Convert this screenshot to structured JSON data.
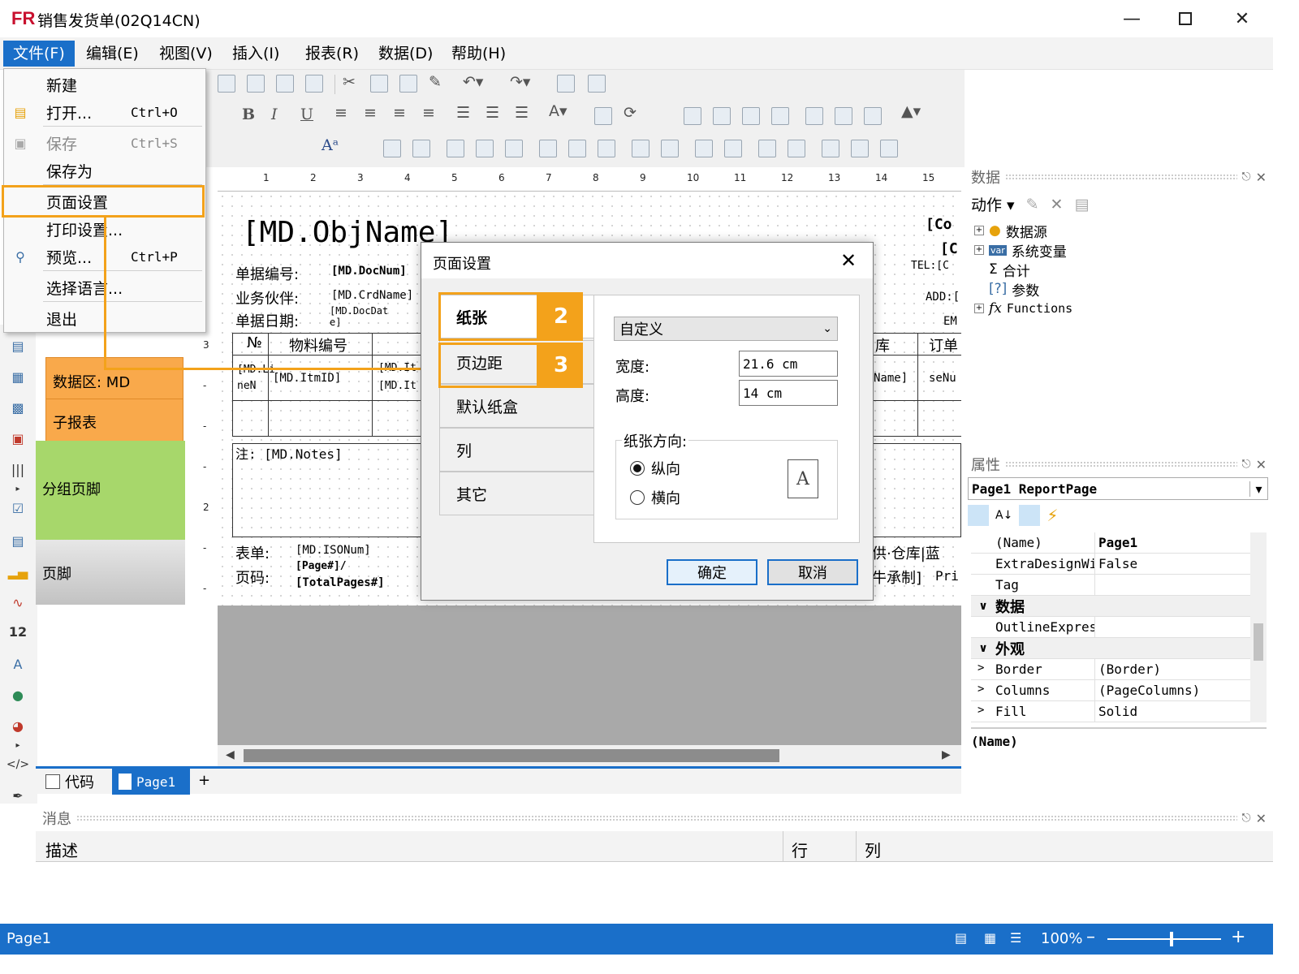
{
  "window": {
    "title": "销售发货单(02Q14CN)",
    "logo": "FR",
    "buttons": [
      "minimize-icon",
      "maximize-icon",
      "close-icon"
    ]
  },
  "menubar": [
    "文件(F)",
    "编辑(E)",
    "视图(V)",
    "插入(I)",
    "报表(R)",
    "数据(D)",
    "帮助(H)"
  ],
  "file_menu": {
    "items": [
      {
        "label": "新建",
        "shortcut": ""
      },
      {
        "label": "打开...",
        "shortcut": "Ctrl+O"
      },
      {
        "label": "保存",
        "shortcut": "Ctrl+S",
        "disabled": true
      },
      {
        "label": "保存为",
        "shortcut": ""
      },
      {
        "label": "页面设置",
        "shortcut": "",
        "highlighted": true
      },
      {
        "label": "打印设置...",
        "shortcut": ""
      },
      {
        "label": "预览...",
        "shortcut": "Ctrl+P"
      },
      {
        "label": "选择语言...",
        "shortcut": ""
      },
      {
        "label": "退出",
        "shortcut": ""
      }
    ]
  },
  "bands": {
    "data": "数据区: MD",
    "subreport": "子报表",
    "group_footer": "分组页脚",
    "page_footer": "页脚"
  },
  "ruler": [
    "1",
    "2",
    "3",
    "4",
    "5",
    "6",
    "7",
    "8",
    "9",
    "10",
    "11",
    "12",
    "13",
    "14",
    "15"
  ],
  "vruler": [
    "3",
    "-",
    "-",
    "-",
    "2",
    "-",
    "-"
  ],
  "report": {
    "objname": "[MD.ObjName]",
    "comp1": "[Co",
    "comp2": "[C",
    "tel": "TEL:[C",
    "add": "ADD:[",
    "em": "EM",
    "docnum_label": "单据编号:",
    "docnum": "[MD.DocNum]",
    "partner_label": "业务伙伴:",
    "partner": "[MD.CrdName]",
    "date_label": "单据日期:",
    "date": "[MD.DocDat e]",
    "col_no": "№",
    "col_item": "物料编号",
    "col_wh": "库",
    "col_order": "订单",
    "cell_line": "[MD.Li neN",
    "cell_itm": "[MD.ItmID]",
    "cell_it1": "[MD.It",
    "cell_it2": "[MD.It",
    "cell_name": "Name]",
    "cell_seq": "seNu",
    "notes": "注: [MD.Notes]",
    "form_label": "表单:",
    "form": "[MD.ISONum]",
    "page_label": "页码:",
    "page": "[Page#]/",
    "total": "[TotalPages#]",
    "right1": "供·仓库|蓝",
    "right2": "牛承制]",
    "right3": "Pri"
  },
  "tabs": {
    "code": "代码",
    "page1": "Page1",
    "add": "+"
  },
  "data_panel": {
    "title": "数据",
    "action": "动作",
    "tree": [
      {
        "label": "数据源",
        "icon": "database-icon"
      },
      {
        "label": "系统变量",
        "icon": "variable-icon"
      },
      {
        "label": "合计",
        "icon": "sum-icon"
      },
      {
        "label": "参数",
        "icon": "parameter-icon"
      },
      {
        "label": "Functions",
        "icon": "function-icon"
      }
    ]
  },
  "props_panel": {
    "title": "属性",
    "object": "Page1 ReportPage",
    "rows": [
      {
        "key": "(Name)",
        "val": "Page1",
        "bold": true
      },
      {
        "key": "ExtraDesignWi",
        "val": "False"
      },
      {
        "key": "Tag",
        "val": ""
      },
      {
        "cat": "数据"
      },
      {
        "key": "OutlineExpres",
        "val": ""
      },
      {
        "cat": "外观"
      },
      {
        "key": "Border",
        "val": "(Border)",
        "exp": true
      },
      {
        "key": "Columns",
        "val": "(PageColumns)",
        "exp": true
      },
      {
        "key": "Fill",
        "val": "Solid",
        "exp": true
      }
    ],
    "desc": "(Name)"
  },
  "messages": {
    "title": "消息",
    "col_desc": "描述",
    "col_row": "行",
    "col_col": "列"
  },
  "status": {
    "page": "Page1",
    "zoom": "100%",
    "zoom_level": 0.55
  },
  "dialog": {
    "title": "页面设置",
    "tabs": [
      "纸张",
      "页边距",
      "默认纸盒",
      "列",
      "其它"
    ],
    "paper": "自定义",
    "width_label": "宽度:",
    "width": "21.6 cm",
    "height_label": "高度:",
    "height": "14 cm",
    "orient_label": "纸张方向:",
    "portrait": "纵向",
    "landscape": "横向",
    "ok": "确定",
    "cancel": "取消"
  },
  "annotations": {
    "badge2": "2",
    "badge3": "3",
    "color": "#f3a21b"
  },
  "colors": {
    "accent": "#1a6fc9",
    "data_band": "#f9a94b",
    "group_band": "#a7d76b"
  }
}
